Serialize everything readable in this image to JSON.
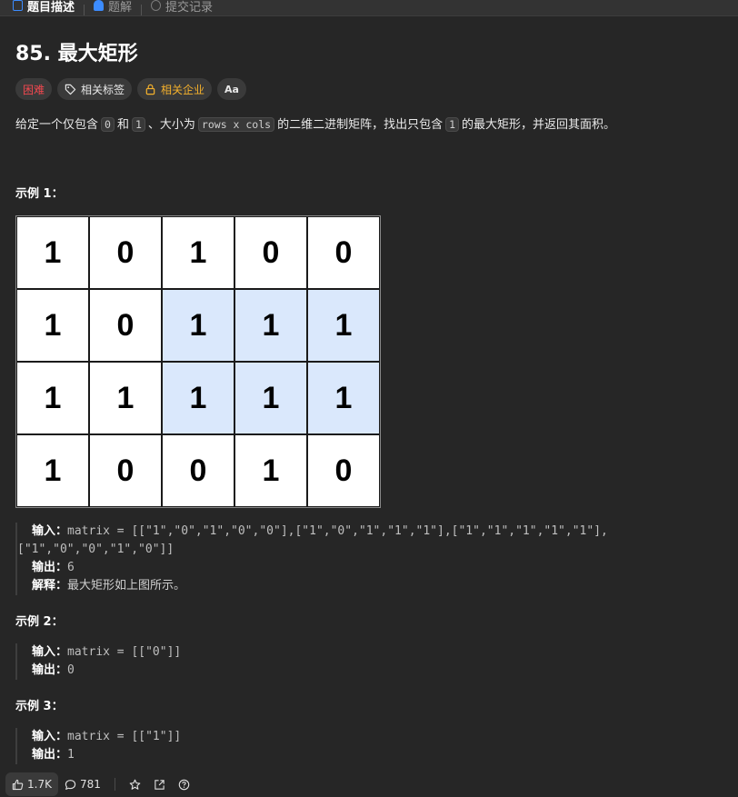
{
  "tabs": [
    {
      "label": "题目描述",
      "active": true
    },
    {
      "label": "题解",
      "active": false
    },
    {
      "label": "提交记录",
      "active": false
    }
  ],
  "problem": {
    "title": "85. 最大矩形",
    "difficulty": "困难",
    "tag_topics": "相关标签",
    "tag_companies": "相关企业",
    "tag_font": "Aa",
    "desc_parts": {
      "p1": "给定一个仅包含",
      "c1": "0",
      "p2": "和",
      "c2": "1",
      "p3": "、大小为",
      "c3": "rows x cols",
      "p4": "的二维二进制矩阵，找出只包含",
      "c4": "1",
      "p5": "的最大矩形，并返回其面积。"
    }
  },
  "examples": [
    {
      "title": "示例 1：",
      "input_label": "输入：",
      "input_line1": "matrix = [[\"1\",\"0\",\"1\",\"0\",\"0\"],[\"1\",\"0\",\"1\",\"1\",\"1\"],[\"1\",\"1\",\"1\",\"1\",\"1\"],",
      "input_line2": "[\"1\",\"0\",\"0\",\"1\",\"0\"]]",
      "output_label": "输出：",
      "output": "6",
      "explain_label": "解释：",
      "explain": "最大矩形如上图所示。"
    },
    {
      "title": "示例 2：",
      "input_label": "输入：",
      "input": "matrix = [[\"0\"]]",
      "output_label": "输出：",
      "output": "0"
    },
    {
      "title": "示例 3：",
      "input_label": "输入：",
      "input": "matrix = [[\"1\"]]",
      "output_label": "输出：",
      "output": "1"
    }
  ],
  "matrix_figure": {
    "rows": [
      [
        "1",
        "0",
        "1",
        "0",
        "0"
      ],
      [
        "1",
        "0",
        "1",
        "1",
        "1"
      ],
      [
        "1",
        "1",
        "1",
        "1",
        "1"
      ],
      [
        "1",
        "0",
        "0",
        "1",
        "0"
      ]
    ],
    "highlight": [
      [
        1,
        2
      ],
      [
        1,
        3
      ],
      [
        1,
        4
      ],
      [
        2,
        2
      ],
      [
        2,
        3
      ],
      [
        2,
        4
      ]
    ],
    "highlight_color": "#dae8fc"
  },
  "bottom_bar": {
    "likes": "1.7K",
    "comments": "781"
  },
  "colors": {
    "background": "#262626",
    "hard": "#f0484f",
    "company": "#f5b12c",
    "accent": "#3c8cff"
  }
}
